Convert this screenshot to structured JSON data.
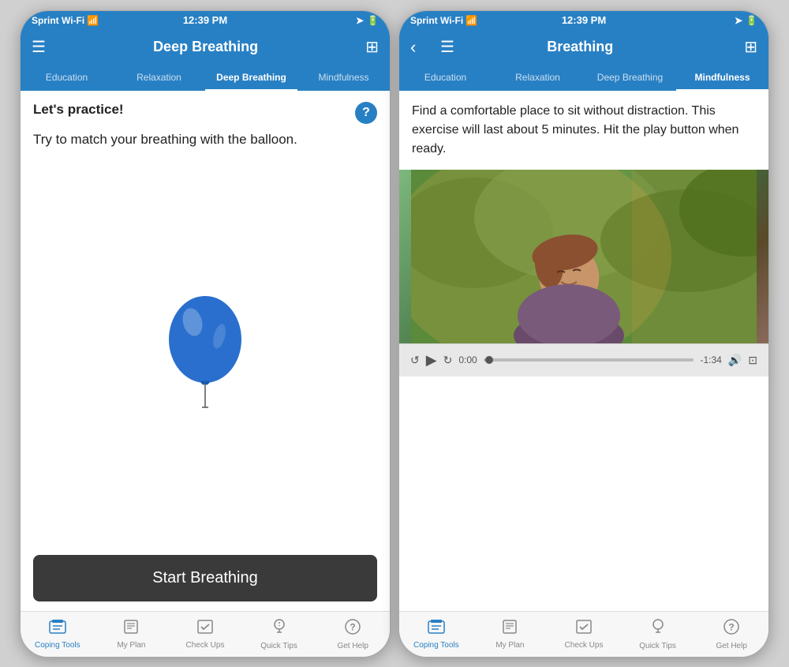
{
  "phones": [
    {
      "id": "left",
      "statusBar": {
        "carrier": "Sprint Wi-Fi",
        "time": "12:39 PM",
        "signal": "▲"
      },
      "navBar": {
        "title": "Deep Breathing",
        "hasMenu": true,
        "hasSettings": true,
        "hasBack": false
      },
      "tabs": [
        {
          "label": "Education",
          "active": false
        },
        {
          "label": "Relaxation",
          "active": false
        },
        {
          "label": "Deep Breathing",
          "active": true
        },
        {
          "label": "Mindfulness",
          "active": false
        }
      ],
      "content": {
        "header": "Let's practice!",
        "subtext": "Try to match your breathing with the balloon.",
        "helpIcon": "?"
      },
      "startButton": "Start Breathing",
      "bottomTabs": [
        {
          "label": "Coping Tools",
          "icon": "🗂",
          "active": true
        },
        {
          "label": "My Plan",
          "icon": "📋",
          "active": false
        },
        {
          "label": "Check Ups",
          "icon": "✓",
          "active": false
        },
        {
          "label": "Quick Tips",
          "icon": "💡",
          "active": false
        },
        {
          "label": "Get Help",
          "icon": "?",
          "active": false
        }
      ]
    },
    {
      "id": "right",
      "statusBar": {
        "carrier": "Sprint Wi-Fi",
        "time": "12:39 PM",
        "signal": "▲"
      },
      "navBar": {
        "title": "Breathing",
        "hasMenu": true,
        "hasSettings": true,
        "hasBack": true
      },
      "tabs": [
        {
          "label": "Education",
          "active": false
        },
        {
          "label": "Relaxation",
          "active": false
        },
        {
          "label": "Deep Breathing",
          "active": false
        },
        {
          "label": "Mindfulness",
          "active": true
        }
      ],
      "content": {
        "text": "Find a comfortable place to sit without distraction. This exercise will last about 5 minutes. Hit the play button when ready."
      },
      "audioPlayer": {
        "currentTime": "0:00",
        "remaining": "-1:34",
        "progress": 2
      },
      "bottomTabs": [
        {
          "label": "Coping Tools",
          "icon": "🗂",
          "active": true
        },
        {
          "label": "My Plan",
          "icon": "📋",
          "active": false
        },
        {
          "label": "Check Ups",
          "icon": "✓",
          "active": false
        },
        {
          "label": "Quick Tips",
          "icon": "💡",
          "active": false
        },
        {
          "label": "Get Help",
          "icon": "?",
          "active": false
        }
      ]
    }
  ]
}
